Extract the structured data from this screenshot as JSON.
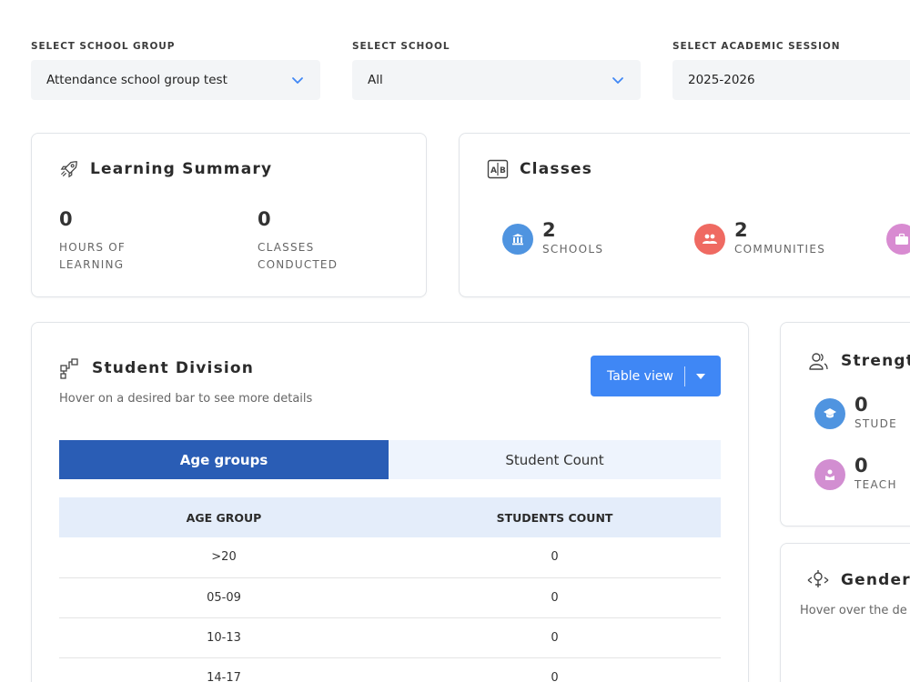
{
  "filters": {
    "school_group": {
      "label": "SELECT SCHOOL GROUP",
      "value": "Attendance school group test"
    },
    "school": {
      "label": "SELECT SCHOOL",
      "value": "All"
    },
    "session": {
      "label": "SELECT ACADEMIC SESSION",
      "value": "2025-2026"
    }
  },
  "learning_summary": {
    "title": "Learning Summary",
    "hours": {
      "value": "0",
      "label_line1": "HOURS OF",
      "label_line2": "LEARNING"
    },
    "classes": {
      "value": "0",
      "label_line1": "CLASSES",
      "label_line2": "CONDUCTED"
    }
  },
  "classes_card": {
    "title": "Classes",
    "stats": [
      {
        "value": "2",
        "label": "SCHOOLS",
        "color": "#4f94e0"
      },
      {
        "value": "2",
        "label": "COMMUNITIES",
        "color": "#ef6a62"
      },
      {
        "color": "#d88bd1"
      }
    ]
  },
  "student_division": {
    "title": "Student Division",
    "subtitle": "Hover on a desired bar to see more details",
    "view_button": "Table view",
    "tabs": [
      "Age groups",
      "Student Count"
    ],
    "table": {
      "headers": [
        "AGE GROUP",
        "STUDENTS COUNT"
      ],
      "rows": [
        [
          ">20",
          "0"
        ],
        [
          "05-09",
          "0"
        ],
        [
          "10-13",
          "0"
        ],
        [
          "14-17",
          "0"
        ]
      ]
    }
  },
  "strength": {
    "title": "Strengt",
    "stats": [
      {
        "value": "0",
        "label": "STUDE",
        "color": "#4f94e0"
      },
      {
        "value": "0",
        "label": "TEACH",
        "color": "#d28ed1"
      }
    ]
  },
  "genders": {
    "title": "Genders",
    "subtitle": "Hover over the de"
  },
  "colors": {
    "accent": "#3f87f5",
    "tab_active": "#2a5db5",
    "table_header": "#e4edfa"
  }
}
